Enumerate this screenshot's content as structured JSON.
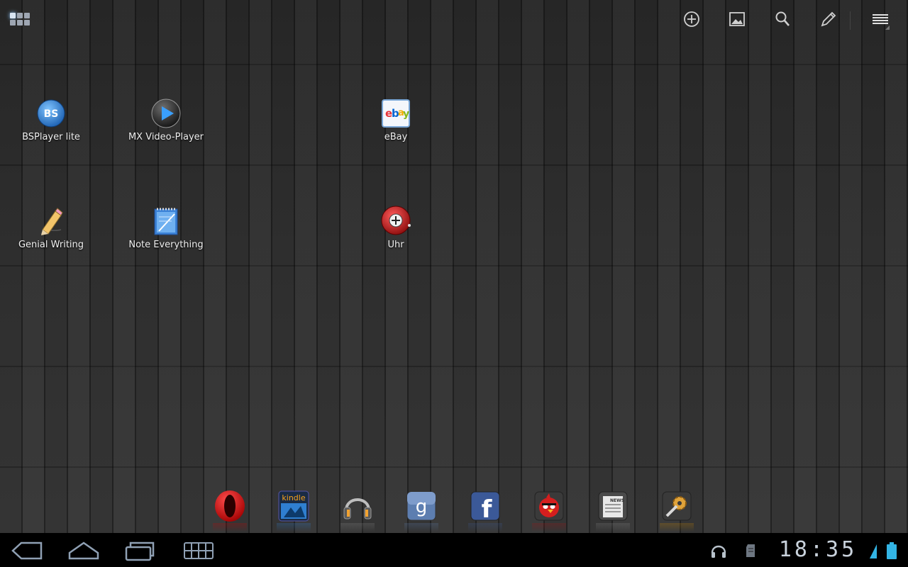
{
  "shortcuts": [
    {
      "label": "BSPlayer lite",
      "icon": "bsplayer-icon"
    },
    {
      "label": "MX Video-Player",
      "icon": "play-icon"
    },
    {
      "label": "eBay",
      "icon": "ebay-icon"
    },
    {
      "label": "Genial Writing",
      "icon": "pencil-icon"
    },
    {
      "label": "Note Everything",
      "icon": "notepad-icon"
    },
    {
      "label": "Uhr",
      "icon": "clock-icon"
    }
  ],
  "dock": [
    {
      "name": "opera",
      "icon": "opera-icon"
    },
    {
      "name": "kindle",
      "label": "kindle",
      "icon": "kindle-icon"
    },
    {
      "name": "music",
      "icon": "headphones-icon"
    },
    {
      "name": "google",
      "label": "g",
      "icon": "google-icon"
    },
    {
      "name": "facebook",
      "label": "f",
      "icon": "facebook-icon"
    },
    {
      "name": "angry-birds",
      "icon": "angry-bird-icon"
    },
    {
      "name": "news",
      "label": "NEWS",
      "icon": "newspaper-icon"
    },
    {
      "name": "settings",
      "icon": "gear-icon"
    }
  ],
  "status": {
    "time": "18:35",
    "icons": [
      "headphones-icon",
      "sd-card-icon",
      "wifi-signal-icon",
      "battery-icon"
    ]
  },
  "colors": {
    "accent": "#33b5e5",
    "label_text": "#f0f0f0",
    "clock_text": "#c9d2dc"
  }
}
